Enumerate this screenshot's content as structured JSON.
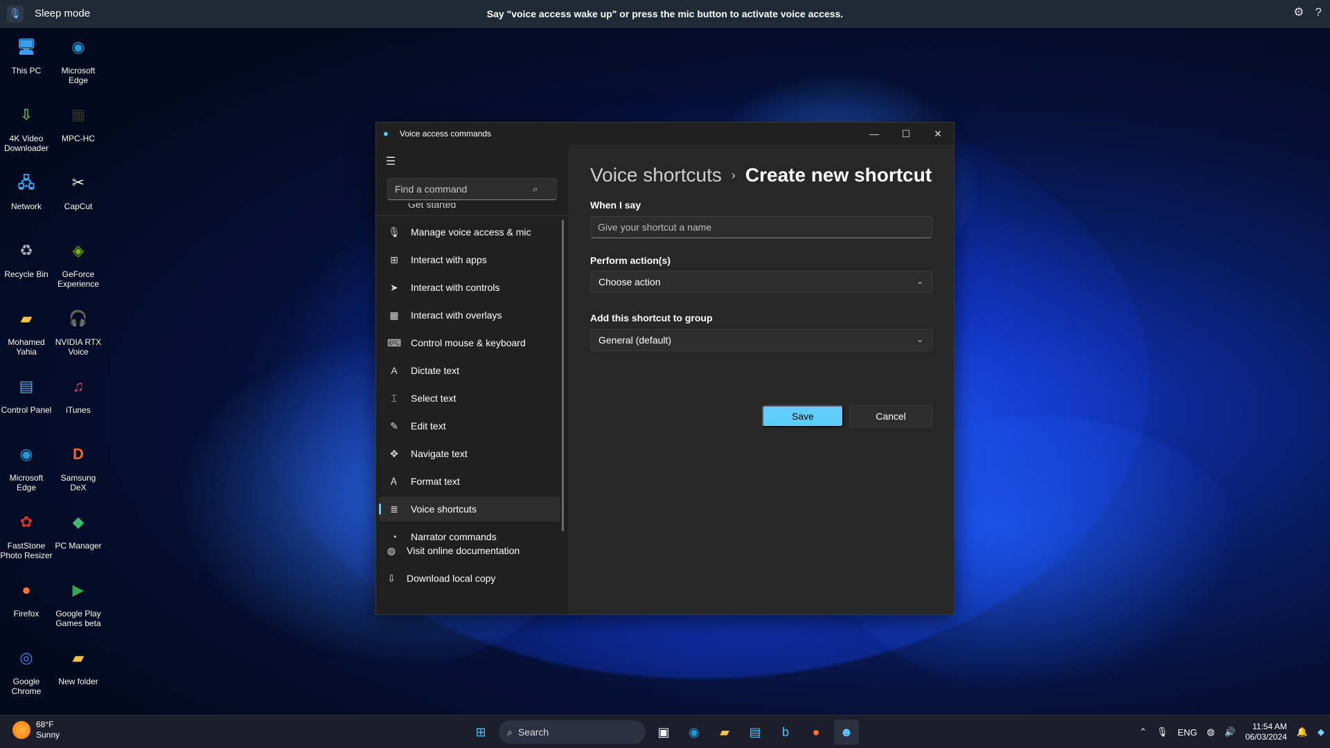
{
  "voice_bar": {
    "mode": "Sleep mode",
    "hint": "Say \"voice access wake up\" or press the mic button to activate voice access."
  },
  "desktop_icons": [
    {
      "label": "This PC",
      "icon": "monitor-icon",
      "color": "#3aa0f0"
    },
    {
      "label": "Microsoft Edge",
      "icon": "edge-icon",
      "color": "#1a9be0"
    },
    {
      "label": "4K Video Downloader",
      "icon": "download-cloud-icon",
      "color": "#5cb85c"
    },
    {
      "label": "MPC-HC",
      "icon": "clapperboard-icon",
      "color": "#333333"
    },
    {
      "label": "Network",
      "icon": "network-icon",
      "color": "#3aa0f0"
    },
    {
      "label": "CapCut",
      "icon": "capcut-icon",
      "color": "#ffffff"
    },
    {
      "label": "Recycle Bin",
      "icon": "recycle-bin-icon",
      "color": "#9fb4c8"
    },
    {
      "label": "GeForce Experience",
      "icon": "nvidia-icon",
      "color": "#76b900"
    },
    {
      "label": "Mohamed Yahia",
      "icon": "folder-icon",
      "color": "#f5c542"
    },
    {
      "label": "NVIDIA RTX Voice",
      "icon": "headset-icon",
      "color": "#76b900"
    },
    {
      "label": "Control Panel",
      "icon": "control-panel-icon",
      "color": "#5aa9e6"
    },
    {
      "label": "iTunes",
      "icon": "music-icon",
      "color": "#e8447c"
    },
    {
      "label": "Microsoft Edge",
      "icon": "edge-icon",
      "color": "#1a9be0"
    },
    {
      "label": "Samsung DeX",
      "icon": "dex-icon",
      "color": "#f26a2e"
    },
    {
      "label": "FastStone Photo Resizer",
      "icon": "photo-resizer-icon",
      "color": "#e03030"
    },
    {
      "label": "PC Manager",
      "icon": "pc-manager-icon",
      "color": "#3db87a"
    },
    {
      "label": "Firefox",
      "icon": "firefox-icon",
      "color": "#ff7139"
    },
    {
      "label": "Google Play Games beta",
      "icon": "play-games-icon",
      "color": "#34a853"
    },
    {
      "label": "Google Chrome",
      "icon": "chrome-icon",
      "color": "#4285f4"
    },
    {
      "label": "New folder",
      "icon": "folder-icon",
      "color": "#f5c542"
    }
  ],
  "window": {
    "title": "Voice access commands",
    "search_placeholder": "Find a command",
    "partial_item": "Get started",
    "nav_items": [
      {
        "label": "Manage voice access & mic",
        "icon": "mic-icon"
      },
      {
        "label": "Interact with apps",
        "icon": "apps-grid-icon"
      },
      {
        "label": "Interact with controls",
        "icon": "pointer-icon"
      },
      {
        "label": "Interact with overlays",
        "icon": "grid-overlay-icon"
      },
      {
        "label": "Control mouse & keyboard",
        "icon": "keyboard-icon"
      },
      {
        "label": "Dictate text",
        "icon": "dictate-icon"
      },
      {
        "label": "Select text",
        "icon": "select-text-icon"
      },
      {
        "label": "Edit text",
        "icon": "edit-text-icon"
      },
      {
        "label": "Navigate text",
        "icon": "navigate-icon"
      },
      {
        "label": "Format text",
        "icon": "format-text-icon"
      },
      {
        "label": "Voice shortcuts",
        "icon": "voice-shortcuts-icon"
      },
      {
        "label": "Narrator commands",
        "icon": "narrator-icon"
      }
    ],
    "bottom_links": [
      {
        "label": "Visit online documentation",
        "icon": "globe-icon"
      },
      {
        "label": "Download local copy",
        "icon": "download-icon"
      }
    ],
    "breadcrumb": {
      "parent": "Voice shortcuts",
      "current": "Create new shortcut"
    },
    "form": {
      "when_label": "When I say",
      "name_placeholder": "Give your shortcut a name",
      "actions_label": "Perform action(s)",
      "actions_value": "Choose action",
      "group_label": "Add this shortcut to group",
      "group_value": "General (default)",
      "save": "Save",
      "cancel": "Cancel"
    }
  },
  "taskbar": {
    "temp": "68°F",
    "condition": "Sunny",
    "search": "Search",
    "lang": "ENG",
    "time": "11:54 AM",
    "date": "06/03/2024"
  },
  "colors": {
    "accent": "#60cdff",
    "window_bg": "#202020",
    "content_bg": "#272727"
  }
}
